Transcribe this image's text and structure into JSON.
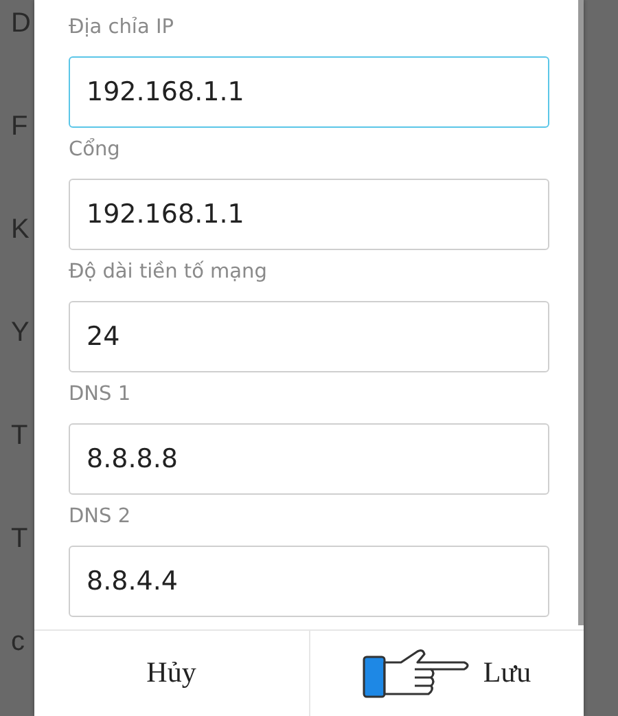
{
  "background_items": [
    {
      "text": "D"
    },
    {
      "text": "F"
    },
    {
      "text": "K"
    },
    {
      "text": "Y"
    },
    {
      "text": "T"
    },
    {
      "text": "T"
    },
    {
      "text": "c"
    }
  ],
  "dialog": {
    "fields": [
      {
        "label": "Địa chỉa IP",
        "value": "192.168.1.1",
        "focused": true
      },
      {
        "label": "Cổng",
        "value": "192.168.1.1",
        "focused": false
      },
      {
        "label": "Độ dài tiền tố mạng",
        "value": "24",
        "focused": false
      },
      {
        "label": "DNS 1",
        "value": "8.8.8.8",
        "focused": false
      },
      {
        "label": "DNS 2",
        "value": "8.8.4.4",
        "focused": false
      }
    ],
    "buttons": [
      {
        "label": "Hủy",
        "pointer": false
      },
      {
        "label": "Lưu",
        "pointer": true
      }
    ]
  }
}
